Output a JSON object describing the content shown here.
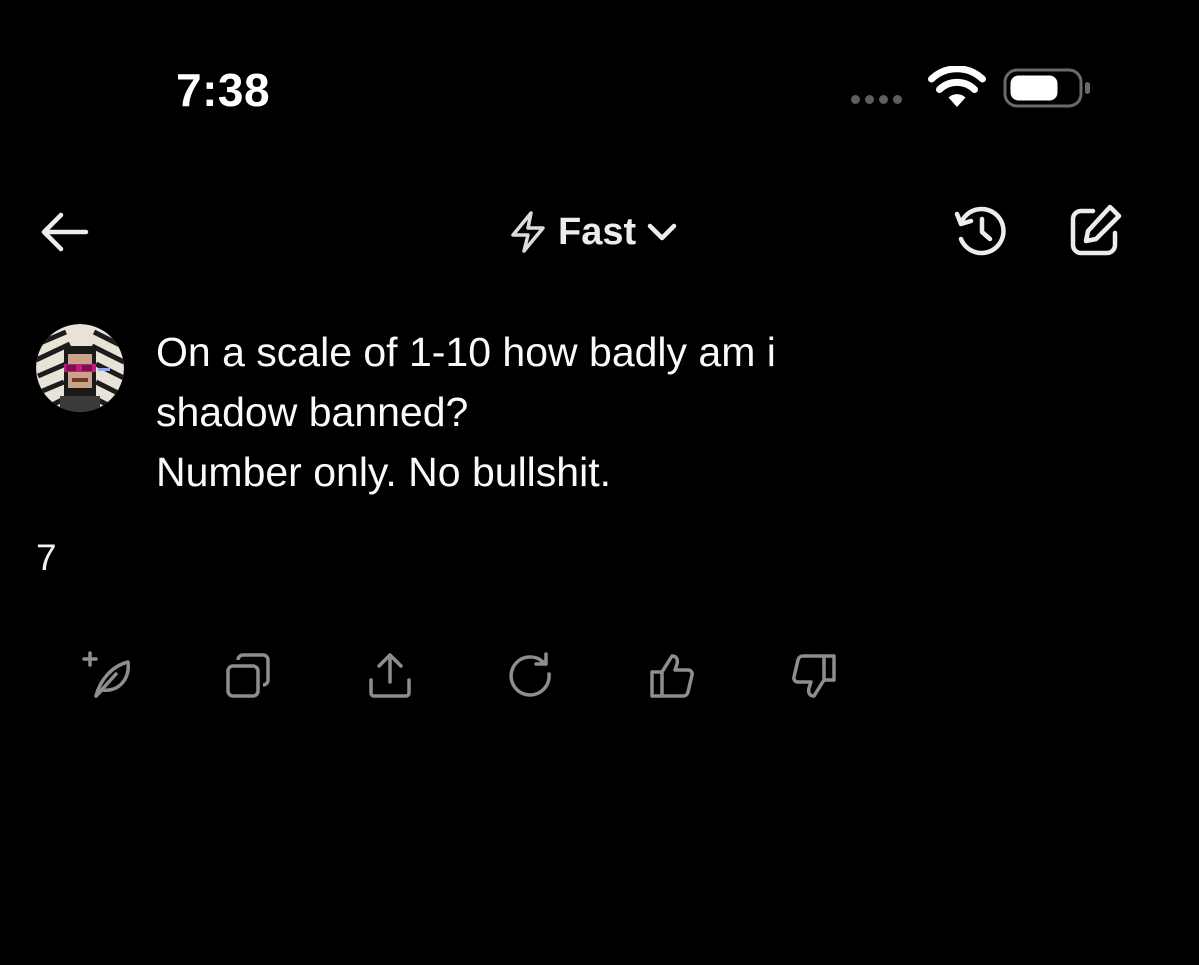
{
  "status_bar": {
    "time": "7:38",
    "signal_icon": "signal-dots-icon",
    "wifi_icon": "wifi-icon",
    "battery_icon": "battery-icon"
  },
  "header": {
    "back_icon": "arrow-left-icon",
    "model_icon": "lightning-icon",
    "model_label": "Fast",
    "model_chevron_icon": "chevron-down-icon",
    "history_icon": "history-icon",
    "compose_icon": "compose-icon"
  },
  "conversation": {
    "user_message": {
      "lines": [
        "On a scale of 1-10 how badly am i",
        "shadow banned?",
        "Number only. No bullshit."
      ]
    },
    "assistant_reply": "7"
  },
  "actions": [
    {
      "icon": "leaf-plus-icon"
    },
    {
      "icon": "copy-icon"
    },
    {
      "icon": "share-icon"
    },
    {
      "icon": "regenerate-icon"
    },
    {
      "icon": "thumbs-up-icon"
    },
    {
      "icon": "thumbs-down-icon"
    }
  ],
  "colors": {
    "background": "#000000",
    "text": "#ffffff",
    "icon_muted": "#8e8e8e"
  }
}
